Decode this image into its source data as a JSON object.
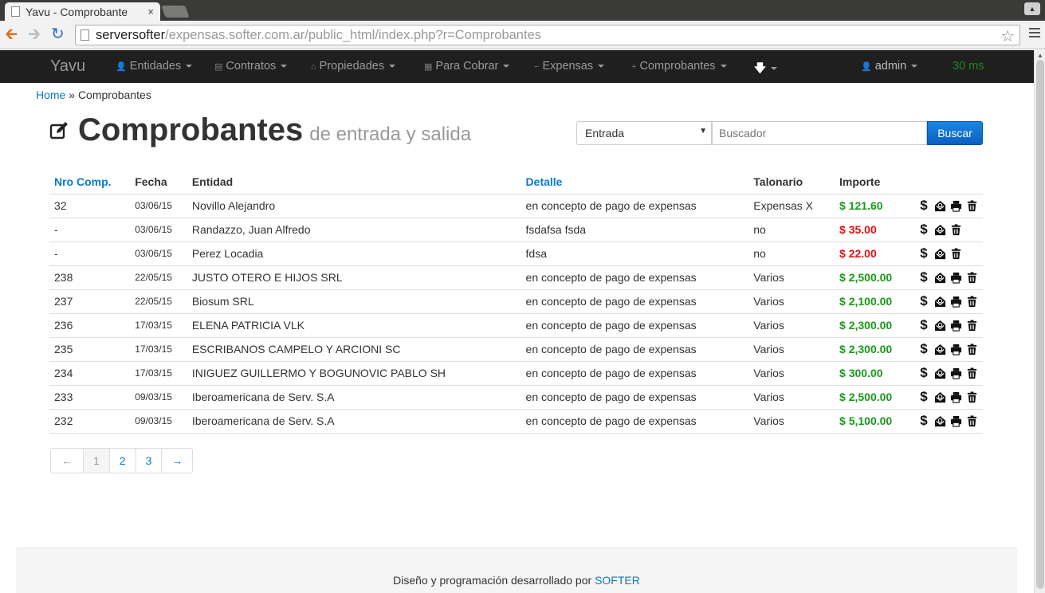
{
  "browser": {
    "tab_title": "Yavu - Comprobante",
    "tab_close": "×",
    "url_host": "serversofter",
    "url_path": "/expensas.softer.com.ar/public_html/index.php?r=Comprobantes"
  },
  "navbar": {
    "brand": "Yavu",
    "items": [
      {
        "label": "Entidades",
        "icon": "user-icon"
      },
      {
        "label": "Contratos",
        "icon": "document-icon"
      },
      {
        "label": "Propiedades",
        "icon": "home-icon"
      },
      {
        "label": "Para Cobrar",
        "icon": "calculator-icon"
      },
      {
        "label": "Expensas",
        "icon": "minus-icon"
      },
      {
        "label": "Comprobantes",
        "icon": "plus-icon"
      }
    ],
    "user": "admin",
    "timing": "30 ms"
  },
  "breadcrumb": {
    "home": "Home",
    "sep": "»",
    "current": "Comprobantes"
  },
  "page": {
    "title": "Comprobantes",
    "subtitle": "de entrada y salida"
  },
  "search": {
    "type_selected": "Entrada",
    "placeholder": "Buscador",
    "button": "Buscar"
  },
  "table": {
    "headers": [
      "Nro Comp.",
      "Fecha",
      "Entidad",
      "Detalle",
      "Talonario",
      "Importe"
    ],
    "rows": [
      {
        "nro": "32",
        "fecha": "03/06/15",
        "entidad": "Novillo Alejandro",
        "detalle": "en concepto de pago de expensas",
        "talonario": "Expensas X",
        "importe": "$ 121.60",
        "status": "green",
        "print": true
      },
      {
        "nro": "-",
        "fecha": "03/06/15",
        "entidad": "Randazzo, Juan Alfredo",
        "detalle": "fsdafsa fsda",
        "talonario": "no",
        "importe": "$ 35.00",
        "status": "red",
        "print": false
      },
      {
        "nro": "-",
        "fecha": "03/06/15",
        "entidad": "Perez Locadia",
        "detalle": "fdsa",
        "talonario": "no",
        "importe": "$ 22.00",
        "status": "red",
        "print": false
      },
      {
        "nro": "238",
        "fecha": "22/05/15",
        "entidad": "JUSTO OTERO E HIJOS SRL",
        "detalle": "en concepto de pago de expensas",
        "talonario": "Varios",
        "importe": "$ 2,500.00",
        "status": "green",
        "print": true
      },
      {
        "nro": "237",
        "fecha": "22/05/15",
        "entidad": "Biosum SRL",
        "detalle": "en concepto de pago de expensas",
        "talonario": "Varios",
        "importe": "$ 2,100.00",
        "status": "green",
        "print": true
      },
      {
        "nro": "236",
        "fecha": "17/03/15",
        "entidad": "ELENA PATRICIA VLK",
        "detalle": "en concepto de pago de expensas",
        "talonario": "Varios",
        "importe": "$ 2,300.00",
        "status": "green",
        "print": true
      },
      {
        "nro": "235",
        "fecha": "17/03/15",
        "entidad": "ESCRIBANOS CAMPELO Y ARCIONI SC",
        "detalle": "en concepto de pago de expensas",
        "talonario": "Varios",
        "importe": "$ 2,300.00",
        "status": "green",
        "print": true
      },
      {
        "nro": "234",
        "fecha": "17/03/15",
        "entidad": "INIGUEZ GUILLERMO Y BOGUNOVIC PABLO SH",
        "detalle": "en concepto de pago de expensas",
        "talonario": "Varios",
        "importe": "$ 300.00",
        "status": "green",
        "print": true
      },
      {
        "nro": "233",
        "fecha": "09/03/15",
        "entidad": "Iberoamericana de Serv. S.A",
        "detalle": "en concepto de pago de expensas",
        "talonario": "Varios",
        "importe": "$ 2,500.00",
        "status": "green",
        "print": true
      },
      {
        "nro": "232",
        "fecha": "09/03/15",
        "entidad": "Iberoamericana de Serv. S.A",
        "detalle": "en concepto de pago de expensas",
        "talonario": "Varios",
        "importe": "$ 5,100.00",
        "status": "green",
        "print": true
      }
    ]
  },
  "pagination": {
    "prev": "←",
    "pages": [
      "1",
      "2",
      "3"
    ],
    "current": "1",
    "next": "→"
  },
  "footer": {
    "text": "Diseño y programación desarrollado por",
    "link": "SOFTER"
  },
  "colors": {
    "positive": "#1a9a1a",
    "negative": "#e21010",
    "accent": "#0a7ac6"
  }
}
